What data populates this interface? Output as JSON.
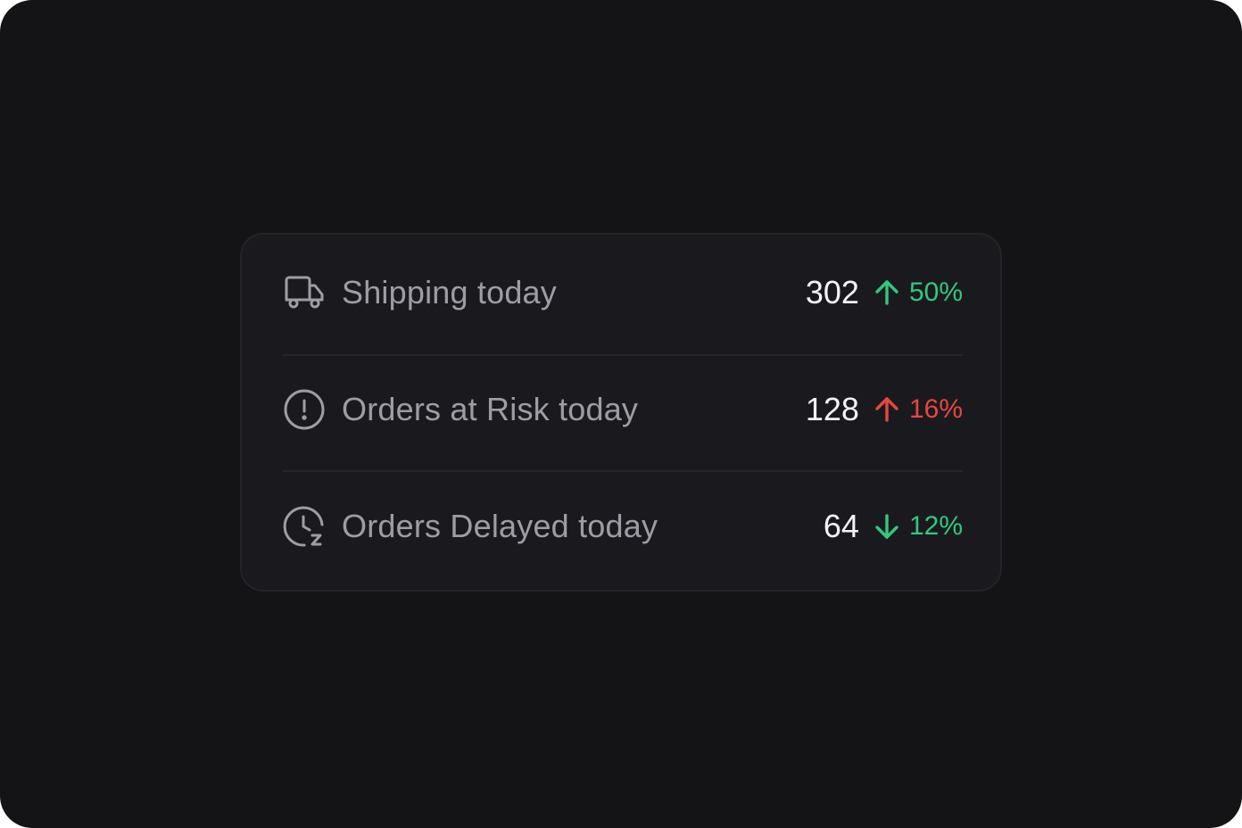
{
  "metrics": [
    {
      "label": "Shipping today",
      "icon": "truck-icon",
      "value": "302",
      "direction": "up",
      "change": "50%",
      "change_color": "#34c77f"
    },
    {
      "label": "Orders at Risk today",
      "icon": "alert-circle-icon",
      "value": "128",
      "direction": "up",
      "change": "16%",
      "change_color": "#e5483f"
    },
    {
      "label": "Orders Delayed today",
      "icon": "clock-snooze-icon",
      "value": "64",
      "direction": "down",
      "change": "12%",
      "change_color": "#34c77f"
    }
  ],
  "colors": {
    "background": "#141416",
    "card": "#1a1a1e",
    "label": "#9d9da5",
    "value": "#f4f4f6",
    "positive": "#34c77f",
    "negative": "#e5483f"
  }
}
